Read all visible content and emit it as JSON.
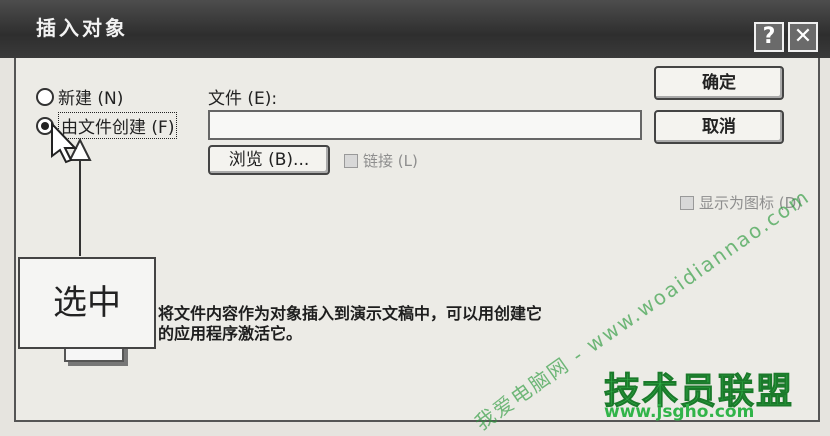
{
  "dialog": {
    "title": "插入对象",
    "help_icon": "?",
    "close_icon": "✕"
  },
  "options": {
    "new_label": "新建 (N)",
    "from_file_label": "由文件创建 (F)"
  },
  "file": {
    "label": "文件 (E):",
    "value": "",
    "browse_label": "浏览 (B)...",
    "link_label": "链接 (L)"
  },
  "buttons": {
    "ok": "确定",
    "cancel": "取消"
  },
  "display_as_icon_label": "显示为图标 (D)",
  "result": {
    "line1": "将文件内容作为对象插入到演示文稿中，可以用创建它",
    "line2": "的应用程序激活它。"
  },
  "annotation": {
    "text": "选中"
  },
  "watermark": {
    "text": "我爱电脑网 - www.woaidiannao.com"
  },
  "logo": {
    "name": "技术员联盟",
    "url": "www.jsgho.com"
  },
  "colors": {
    "logo_green": "#31b449",
    "titlebar": "#3a3a3a"
  }
}
